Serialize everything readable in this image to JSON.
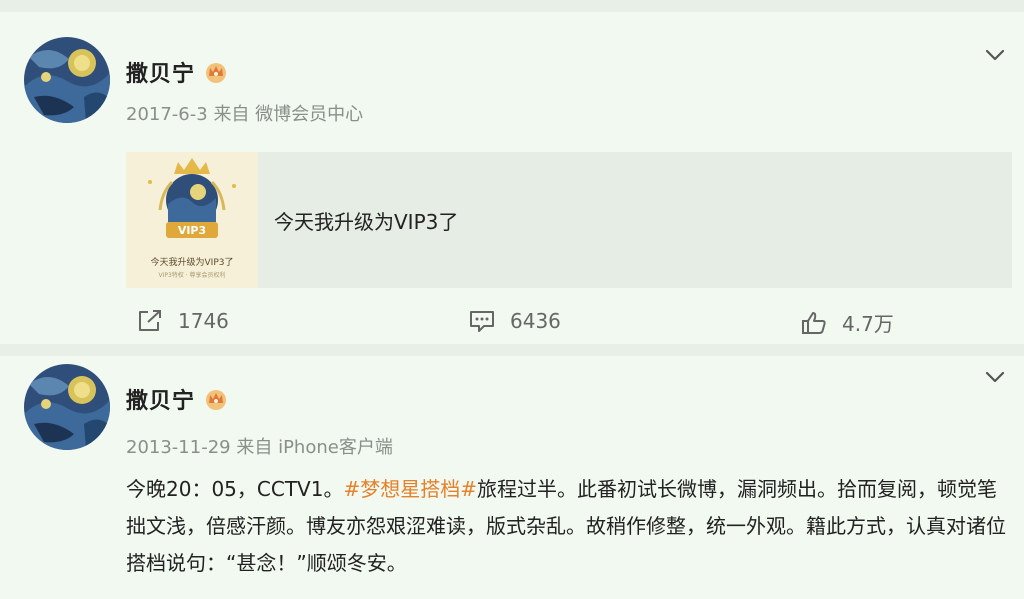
{
  "posts": [
    {
      "author": "撒贝宁",
      "date": "2017-6-3",
      "source_prefix": "来自",
      "source": "微博会员中心",
      "share": {
        "text": "今天我升级为VIP3了",
        "thumb_badge": "VIP3",
        "thumb_caption": "今天我升级为VIP3了",
        "thumb_sub": "VIP3特权 · 尊享会员权利"
      },
      "reposts": "1746",
      "comments": "6436",
      "likes": "4.7万"
    },
    {
      "author": "撒贝宁",
      "date": "2013-11-29",
      "source_prefix": "来自",
      "source": "iPhone客户端",
      "text_before": "今晚20：05，CCTV1。",
      "hashtag": "#梦想星搭档#",
      "text_after": "旅程过半。此番初试长微博，漏洞频出。拾而复阅，顿觉笔拙文浅，倍感汗颜。博友亦怨艰涩难读，版式杂乱。故稍作修整，统一外观。籍此方式，认真对诸位搭档说句：“甚念！”顺颂冬安。"
    }
  ],
  "icons": {
    "crown": "vip-crown-icon",
    "chevron": "chevron-down-icon",
    "repost": "repost-icon",
    "comment": "comment-icon",
    "like": "like-icon"
  },
  "colors": {
    "background": "#e8efe6",
    "card": "#f2f9f0",
    "hashtag": "#e5812a",
    "meta": "#8a8f8a"
  }
}
